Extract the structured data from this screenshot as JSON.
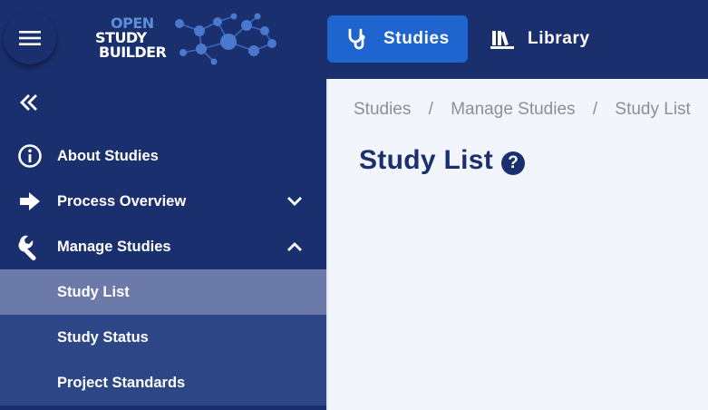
{
  "header": {
    "logo": {
      "line1": "OPEN",
      "line2": "STUDY",
      "line3": "BUILDER"
    },
    "tabs": [
      {
        "label": "Studies",
        "icon": "stethoscope-icon",
        "active": true
      },
      {
        "label": "Library",
        "icon": "books-icon",
        "active": false
      }
    ]
  },
  "sidebar": {
    "items": [
      {
        "label": "About Studies",
        "icon": "info-circle-icon"
      },
      {
        "label": "Process Overview",
        "icon": "arrow-right-icon",
        "chevron": "down"
      },
      {
        "label": "Manage Studies",
        "icon": "wrench-icon",
        "chevron": "up"
      }
    ],
    "subitems": [
      {
        "label": "Study List",
        "active": true
      },
      {
        "label": "Study Status",
        "active": false
      },
      {
        "label": "Project Standards",
        "active": false
      }
    ]
  },
  "breadcrumb": [
    "Studies",
    "Manage Studies",
    "Study List"
  ],
  "breadcrumb_separator": "/",
  "page": {
    "title": "Study List",
    "help_symbol": "?"
  },
  "colors": {
    "navy": "#1a2f6e",
    "active_tab": "#1f65cf",
    "active_subitem": "#6b7aa8",
    "subitem_bg": "#2d4686",
    "content_bg": "#f2f6fc"
  }
}
